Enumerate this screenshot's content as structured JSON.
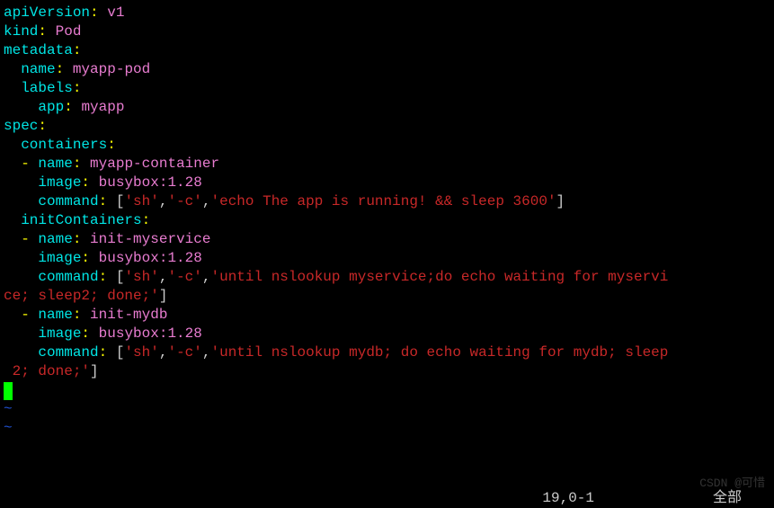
{
  "lines": [
    [
      [
        "key",
        "apiVersion"
      ],
      [
        "colon",
        ":"
      ],
      [
        "plain",
        " "
      ],
      [
        "val",
        "v1"
      ]
    ],
    [
      [
        "key",
        "kind"
      ],
      [
        "colon",
        ":"
      ],
      [
        "plain",
        " "
      ],
      [
        "val",
        "Pod"
      ]
    ],
    [
      [
        "key",
        "metadata"
      ],
      [
        "colon",
        ":"
      ]
    ],
    [
      [
        "plain",
        "  "
      ],
      [
        "key",
        "name"
      ],
      [
        "colon",
        ":"
      ],
      [
        "plain",
        " "
      ],
      [
        "val",
        "myapp-pod"
      ]
    ],
    [
      [
        "plain",
        "  "
      ],
      [
        "key",
        "labels"
      ],
      [
        "colon",
        ":"
      ]
    ],
    [
      [
        "plain",
        "    "
      ],
      [
        "key",
        "app"
      ],
      [
        "colon",
        ":"
      ],
      [
        "plain",
        " "
      ],
      [
        "val",
        "myapp"
      ]
    ],
    [
      [
        "key",
        "spec"
      ],
      [
        "colon",
        ":"
      ]
    ],
    [
      [
        "plain",
        "  "
      ],
      [
        "key",
        "containers"
      ],
      [
        "colon",
        ":"
      ]
    ],
    [
      [
        "plain",
        "  "
      ],
      [
        "dash",
        "-"
      ],
      [
        "plain",
        " "
      ],
      [
        "key",
        "name"
      ],
      [
        "colon",
        ":"
      ],
      [
        "plain",
        " "
      ],
      [
        "val",
        "myapp-container"
      ]
    ],
    [
      [
        "plain",
        "    "
      ],
      [
        "key",
        "image"
      ],
      [
        "colon",
        ":"
      ],
      [
        "plain",
        " "
      ],
      [
        "val",
        "busybox:1.28"
      ]
    ],
    [
      [
        "plain",
        "    "
      ],
      [
        "key",
        "command"
      ],
      [
        "colon",
        ":"
      ],
      [
        "plain",
        " "
      ],
      [
        "bracket",
        "["
      ],
      [
        "str",
        "'sh'"
      ],
      [
        "bracket",
        ","
      ],
      [
        "str",
        "'-c'"
      ],
      [
        "bracket",
        ","
      ],
      [
        "str",
        "'echo The app is running! && sleep 3600'"
      ],
      [
        "bracket",
        "]"
      ]
    ],
    [
      [
        "plain",
        "  "
      ],
      [
        "key",
        "initContainers"
      ],
      [
        "colon",
        ":"
      ]
    ],
    [
      [
        "plain",
        "  "
      ],
      [
        "dash",
        "-"
      ],
      [
        "plain",
        " "
      ],
      [
        "key",
        "name"
      ],
      [
        "colon",
        ":"
      ],
      [
        "plain",
        " "
      ],
      [
        "val",
        "init-myservice"
      ]
    ],
    [
      [
        "plain",
        "    "
      ],
      [
        "key",
        "image"
      ],
      [
        "colon",
        ":"
      ],
      [
        "plain",
        " "
      ],
      [
        "val",
        "busybox:1.28"
      ]
    ],
    [
      [
        "plain",
        "    "
      ],
      [
        "key",
        "command"
      ],
      [
        "colon",
        ":"
      ],
      [
        "plain",
        " "
      ],
      [
        "bracket",
        "["
      ],
      [
        "str",
        "'sh'"
      ],
      [
        "bracket",
        ","
      ],
      [
        "str",
        "'-c'"
      ],
      [
        "bracket",
        ","
      ],
      [
        "str",
        "'until nslookup myservice;do echo waiting for myservi"
      ]
    ],
    [
      [
        "str",
        "ce; sleep2; done;'"
      ],
      [
        "bracket",
        "]"
      ]
    ],
    [
      [
        "plain",
        "  "
      ],
      [
        "dash",
        "-"
      ],
      [
        "plain",
        " "
      ],
      [
        "key",
        "name"
      ],
      [
        "colon",
        ":"
      ],
      [
        "plain",
        " "
      ],
      [
        "val",
        "init-mydb"
      ]
    ],
    [
      [
        "plain",
        "    "
      ],
      [
        "key",
        "image"
      ],
      [
        "colon",
        ":"
      ],
      [
        "plain",
        " "
      ],
      [
        "val",
        "busybox:1.28"
      ]
    ],
    [
      [
        "plain",
        "    "
      ],
      [
        "key",
        "command"
      ],
      [
        "colon",
        ":"
      ],
      [
        "plain",
        " "
      ],
      [
        "bracket",
        "["
      ],
      [
        "str",
        "'sh'"
      ],
      [
        "bracket",
        ","
      ],
      [
        "str",
        "'-c'"
      ],
      [
        "bracket",
        ","
      ],
      [
        "str",
        "'until nslookup mydb; do echo waiting for mydb; sleep"
      ]
    ],
    [
      [
        "str",
        " 2; done;'"
      ],
      [
        "bracket",
        "]"
      ]
    ]
  ],
  "tilde": "~",
  "status": {
    "position": "19,0-1",
    "mode": "全部"
  },
  "watermark": "CSDN @可惜"
}
